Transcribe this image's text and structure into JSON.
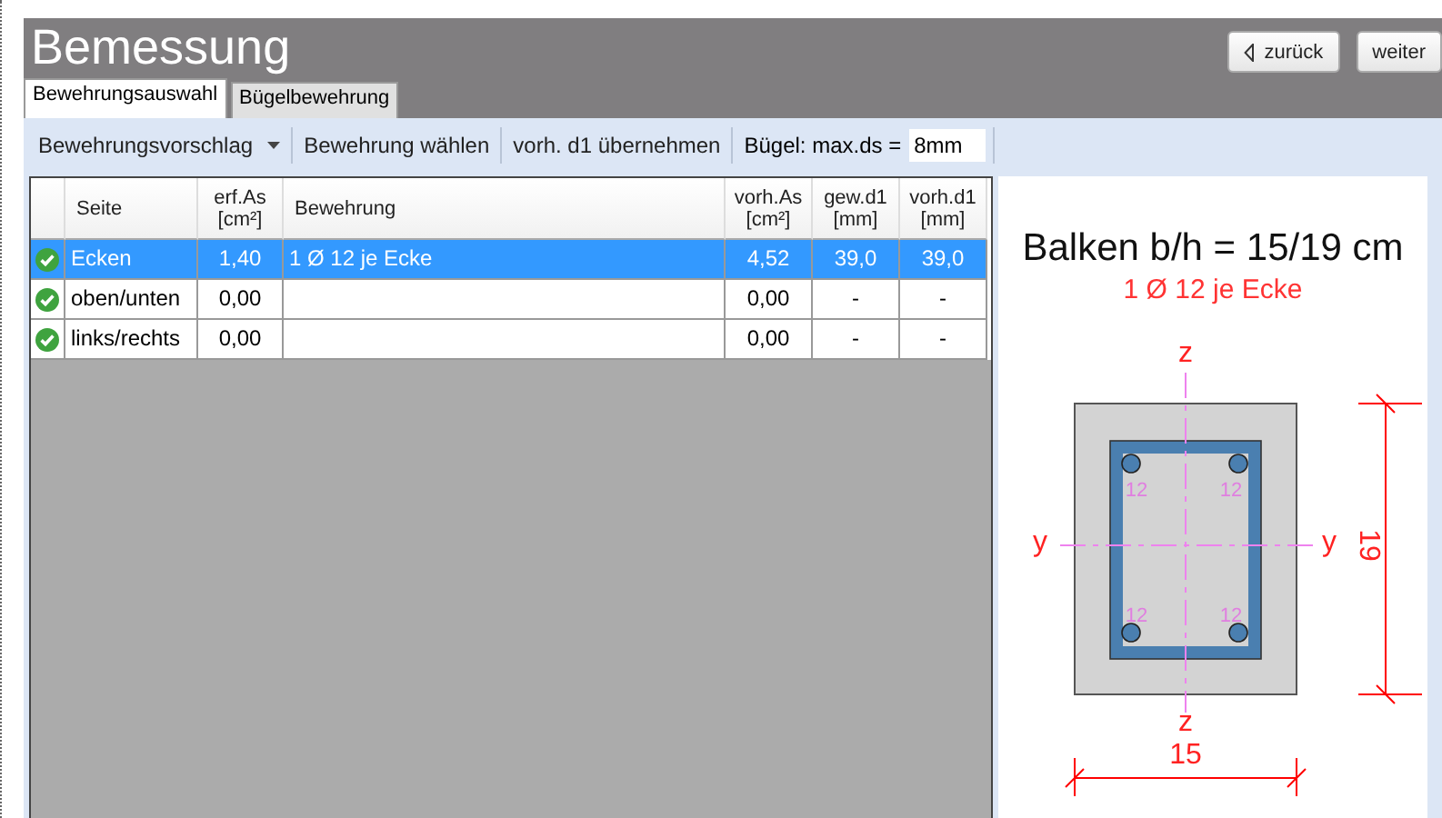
{
  "header": {
    "title": "Bemessung",
    "buttons": [
      {
        "label": "zurück",
        "kind": "back"
      },
      {
        "label": "weiter",
        "kind": "plain"
      }
    ]
  },
  "tabs": [
    {
      "label": "Bewehrungsauswahl",
      "selected": true
    },
    {
      "label": "Bügelbewehrung",
      "selected": false
    }
  ],
  "toolbar": {
    "items": [
      {
        "label": "Bewehrungsvorschlag",
        "kind": "dropdown"
      },
      {
        "label": "Bewehrung wählen",
        "kind": "button"
      },
      {
        "label": "vorh. d1 übernehmen",
        "kind": "button"
      },
      {
        "label": "Bügel: max.ds =",
        "kind": "label"
      }
    ],
    "field_value": "8mm"
  },
  "table": {
    "columns": [
      {
        "name": "Seite"
      },
      {
        "name": "erf.As",
        "unit": "[cm²]"
      },
      {
        "name": "Bewehrung"
      },
      {
        "name": "vorh.As",
        "unit": "[cm²]"
      },
      {
        "name": "gew.d1",
        "unit": "[mm]"
      },
      {
        "name": "vorh.d1",
        "unit": "[mm]"
      }
    ],
    "rows": [
      {
        "ok": true,
        "selected": true,
        "cells": [
          "Ecken",
          "1,40",
          "1 Ø 12 je Ecke",
          "4,52",
          "39,0",
          "39,0"
        ]
      },
      {
        "ok": true,
        "selected": false,
        "cells": [
          "oben/unten",
          "0,00",
          "",
          "0,00",
          "-",
          "-"
        ]
      },
      {
        "ok": true,
        "selected": false,
        "cells": [
          "links/rechts",
          "0,00",
          "",
          "0,00",
          "-",
          "-"
        ]
      }
    ]
  },
  "drawing": {
    "title": "Balken b/h = 15/19 cm",
    "subtitle": "1 Ø 12 je Ecke",
    "z_top": "z",
    "z_bottom": "z",
    "y_left": "y",
    "y_right": "y",
    "bar_labels": [
      "12",
      "12",
      "12",
      "12"
    ],
    "height_label": "19",
    "width_label": "15"
  }
}
